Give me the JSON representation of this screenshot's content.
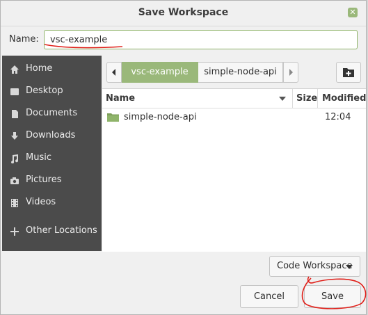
{
  "dialog": {
    "title": "Save Workspace"
  },
  "name_field": {
    "label": "Name:",
    "value": "vsc-example"
  },
  "sidebar": {
    "items": [
      {
        "label": "Home",
        "icon": "home-icon"
      },
      {
        "label": "Desktop",
        "icon": "desktop-icon"
      },
      {
        "label": "Documents",
        "icon": "document-icon"
      },
      {
        "label": "Downloads",
        "icon": "download-icon"
      },
      {
        "label": "Music",
        "icon": "music-icon"
      },
      {
        "label": "Pictures",
        "icon": "camera-icon"
      },
      {
        "label": "Videos",
        "icon": "film-icon"
      },
      {
        "label": "Other Locations",
        "icon": "plus-icon"
      }
    ]
  },
  "pathbar": {
    "crumbs": [
      "vsc-example",
      "simple-node-api"
    ]
  },
  "files": {
    "columns": [
      "Name",
      "Size",
      "Modified"
    ],
    "rows": [
      {
        "name": "simple-node-api",
        "size": "",
        "modified": "12:04"
      }
    ]
  },
  "filter": {
    "selected": "Code Workspace"
  },
  "buttons": {
    "cancel": "Cancel",
    "save": "Save"
  },
  "colors": {
    "accent": "#9ab87a",
    "sidebar_bg": "#4b4b4b",
    "annotation": "#e0201a"
  }
}
